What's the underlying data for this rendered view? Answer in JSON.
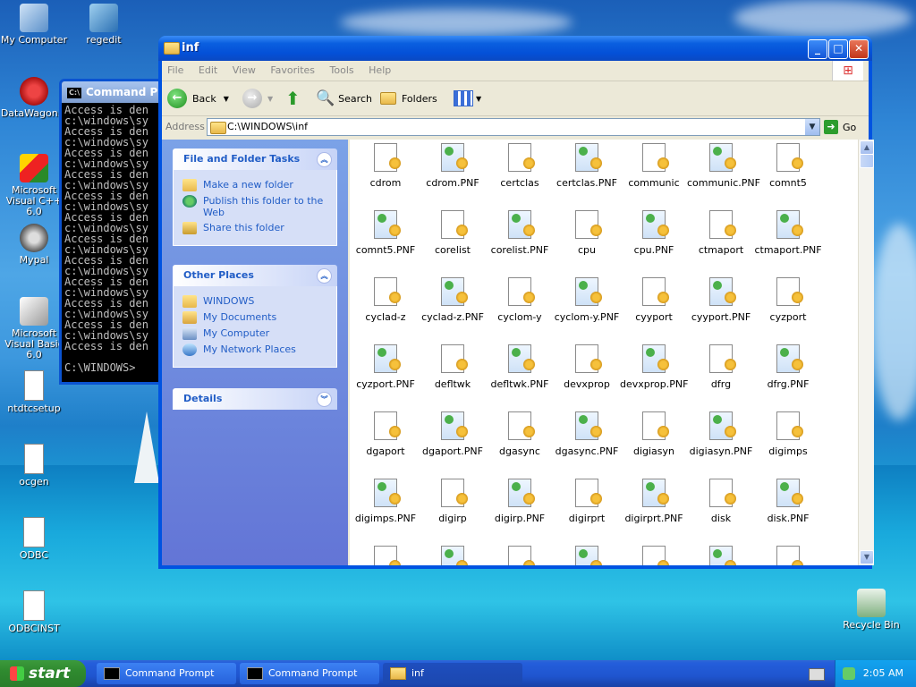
{
  "desktop": {
    "icons": [
      {
        "label": "My Computer",
        "icon": "computer-icon"
      },
      {
        "label": "regedit",
        "icon": "regedit-icon"
      },
      {
        "label": "DataWagon...",
        "icon": "datawagon-icon"
      },
      {
        "label": "Microsoft Visual C++ 6.0",
        "icon": "visual-cpp-icon"
      },
      {
        "label": "Mypal",
        "icon": "mypal-icon"
      },
      {
        "label": "Microsoft Visual Basic 6.0",
        "icon": "visual-basic-icon"
      },
      {
        "label": "ntdtcsetup",
        "icon": "document-icon"
      },
      {
        "label": "ocgen",
        "icon": "document-icon"
      },
      {
        "label": "ODBC",
        "icon": "inf-file-icon"
      },
      {
        "label": "ODBCINST",
        "icon": "inf-file-icon"
      },
      {
        "label": "Recycle Bin",
        "icon": "recycle-bin-icon"
      }
    ]
  },
  "cmd": {
    "title": "Command Pr",
    "lines": [
      "Access is den",
      "c:\\windows\\sy",
      "Access is den",
      "c:\\windows\\sy",
      "Access is den",
      "c:\\windows\\sy",
      "Access is den",
      "c:\\windows\\sy",
      "Access is den",
      "c:\\windows\\sy",
      "Access is den",
      "c:\\windows\\sy",
      "Access is den",
      "c:\\windows\\sy",
      "Access is den",
      "c:\\windows\\sy",
      "Access is den",
      "c:\\windows\\sy",
      "Access is den",
      "c:\\windows\\sy",
      "Access is den",
      "c:\\windows\\sy",
      "Access is den",
      "",
      "C:\\WINDOWS>"
    ]
  },
  "explorer": {
    "title": "inf",
    "menu": [
      "File",
      "Edit",
      "View",
      "Favorites",
      "Tools",
      "Help"
    ],
    "toolbar": {
      "back": "Back",
      "search": "Search",
      "folders": "Folders"
    },
    "address_label": "Address",
    "address_value": "C:\\WINDOWS\\inf",
    "go_label": "Go",
    "tasks_panel": {
      "title": "File and Folder Tasks",
      "items": [
        "Make a new folder",
        "Publish this folder to the Web",
        "Share this folder"
      ]
    },
    "places_panel": {
      "title": "Other Places",
      "items": [
        "WINDOWS",
        "My Documents",
        "My Computer",
        "My Network Places"
      ]
    },
    "details_panel": {
      "title": "Details"
    },
    "files": [
      "cdrom",
      "cdrom.PNF",
      "certclas",
      "certclas.PNF",
      "communic",
      "communic.PNF",
      "comnt5",
      "comnt5.PNF",
      "corelist",
      "corelist.PNF",
      "cpu",
      "cpu.PNF",
      "ctmaport",
      "ctmaport.PNF",
      "cyclad-z",
      "cyclad-z.PNF",
      "cyclom-y",
      "cyclom-y.PNF",
      "cyyport",
      "cyyport.PNF",
      "cyzport",
      "cyzport.PNF",
      "defltwk",
      "defltwk.PNF",
      "devxprop",
      "devxprop.PNF",
      "dfrg",
      "dfrg.PNF",
      "dgaport",
      "dgaport.PNF",
      "dgasync",
      "dgasync.PNF",
      "digiasyn",
      "digiasyn.PNF",
      "digimps",
      "digimps.PNF",
      "digirp",
      "digirp.PNF",
      "digirprt",
      "digirprt.PNF",
      "disk",
      "disk.PNF",
      "",
      "",
      "",
      "",
      "",
      "",
      ""
    ]
  },
  "taskbar": {
    "start_label": "start",
    "buttons": [
      "Command Prompt",
      "Command Prompt",
      "inf"
    ],
    "clock": "2:05 AM"
  }
}
